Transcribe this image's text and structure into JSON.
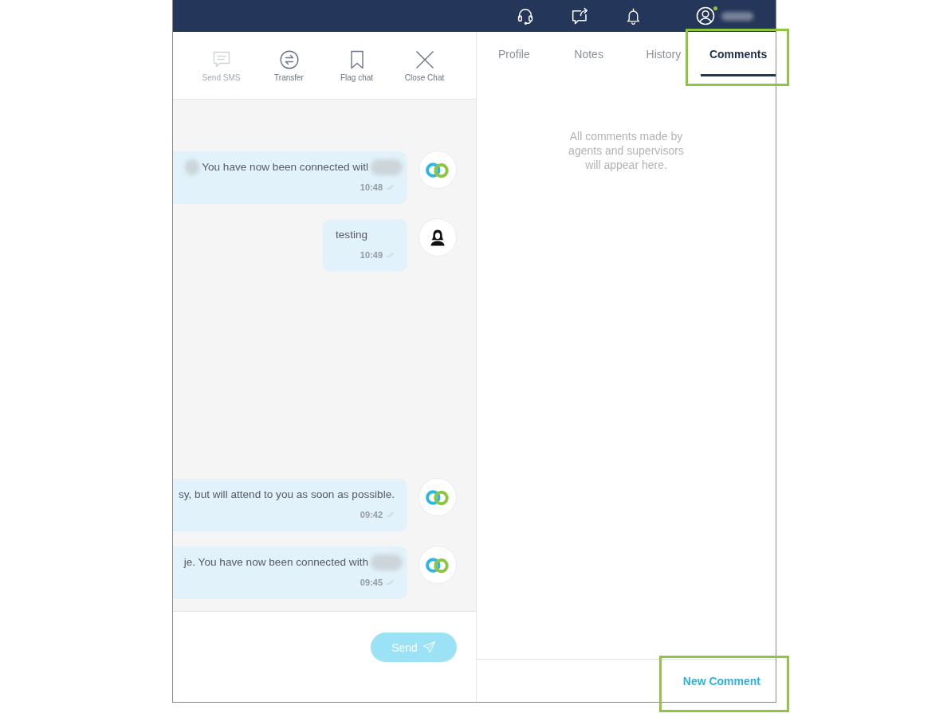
{
  "top_bar": {
    "user": {
      "online": true
    }
  },
  "chat": {
    "toolbar": [
      {
        "kind": "sms",
        "label": "Send SMS",
        "disabled": true
      },
      {
        "kind": "transfer",
        "label": "Transfer",
        "disabled": false
      },
      {
        "kind": "flag",
        "label": "Flag chat",
        "disabled": false
      },
      {
        "kind": "close",
        "label": "Close Chat",
        "disabled": false
      }
    ],
    "message_groups": [
      {
        "messages": [
          {
            "kind": "bot",
            "text": "You have now been connected witl",
            "time": "10:48",
            "clipped_left": true,
            "blurred_start": true,
            "blurred_end": true
          },
          {
            "kind": "agent",
            "text": "testing",
            "time": "10:49",
            "clipped_left": false,
            "blurred_start": false,
            "blurred_end": false
          }
        ]
      },
      {
        "messages": [
          {
            "kind": "bot",
            "text": "sy, but will attend to you as soon as possible.",
            "time": "09:42",
            "clipped_left": true,
            "blurred_start": false,
            "blurred_end": false
          },
          {
            "kind": "bot",
            "text": "je. You have now been connected with",
            "time": "09:45",
            "clipped_left": true,
            "blurred_start": false,
            "blurred_end": true
          }
        ]
      }
    ],
    "send_button": {
      "label": "Send",
      "disabled": true
    }
  },
  "side_panel": {
    "tabs": [
      {
        "label": "Profile",
        "selected": false,
        "highlighted": false
      },
      {
        "label": "Notes",
        "selected": false,
        "highlighted": false
      },
      {
        "label": "History",
        "selected": false,
        "highlighted": false
      },
      {
        "label": "Comments",
        "selected": true,
        "highlighted": true
      }
    ],
    "empty_message": "All comments made by agents and supervisors will appear here.",
    "new_comment": {
      "label": "New Comment",
      "highlighted": true
    }
  }
}
